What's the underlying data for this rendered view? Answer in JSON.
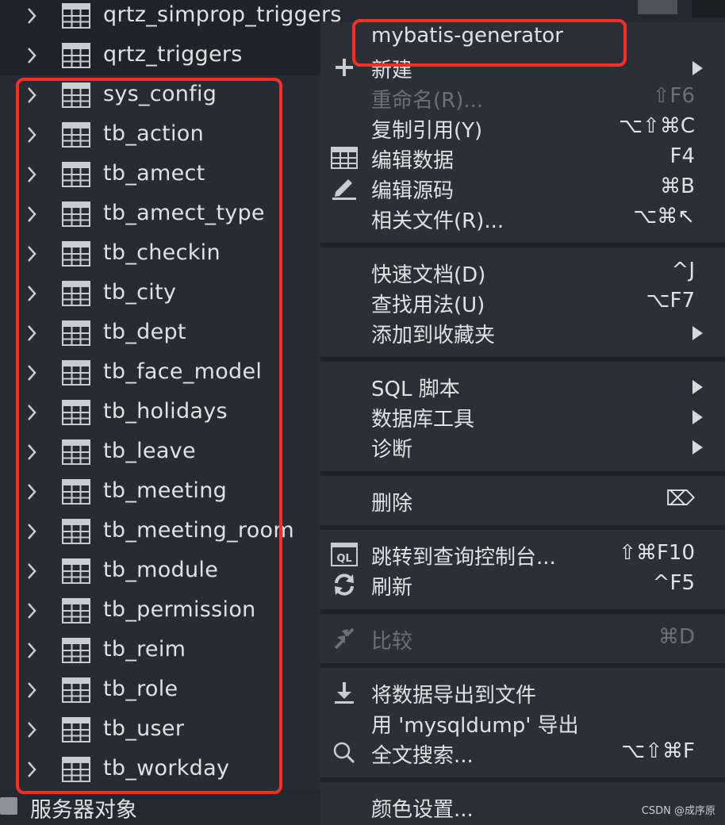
{
  "tree": {
    "partial_rows": [
      "qrtz_simprop_triggers",
      "qrtz_triggers"
    ],
    "tables": [
      "sys_config",
      "tb_action",
      "tb_amect",
      "tb_amect_type",
      "tb_checkin",
      "tb_city",
      "tb_dept",
      "tb_face_model",
      "tb_holidays",
      "tb_leave",
      "tb_meeting",
      "tb_meeting_room",
      "tb_module",
      "tb_permission",
      "tb_reim",
      "tb_role",
      "tb_user",
      "tb_workday"
    ],
    "server_objects_label": "服务器对象"
  },
  "menu": {
    "mybatis_generator": "mybatis-generator",
    "new": "新建",
    "rename": {
      "label": "重命名(R)...",
      "shortcut": "⇧F6"
    },
    "copy_reference": {
      "label": "复制引用(Y)",
      "shortcut": "⌥⇧⌘C"
    },
    "edit_data": {
      "label": "编辑数据",
      "shortcut": "F4"
    },
    "edit_source": {
      "label": "编辑源码",
      "shortcut": "⌘B"
    },
    "related_files": {
      "label": "相关文件(R)...",
      "shortcut": "⌥⌘↖"
    },
    "quick_doc": {
      "label": "快速文档(D)",
      "shortcut": "^J"
    },
    "find_usages": {
      "label": "查找用法(U)",
      "shortcut": "⌥F7"
    },
    "add_to_favorites": "添加到收藏夹",
    "sql_scripts": "SQL 脚本",
    "db_tools": "数据库工具",
    "diagnostics": "诊断",
    "delete": {
      "label": "删除",
      "shortcut": "⌦"
    },
    "jump_to_console": {
      "label": "跳转到查询控制台...",
      "shortcut": "⇧⌘F10"
    },
    "refresh": {
      "label": "刷新",
      "shortcut": "^F5"
    },
    "compare": {
      "label": "比较",
      "shortcut": "⌘D"
    },
    "export_to_file": "将数据导出到文件",
    "mysqldump_export": "用 'mysqldump' 导出",
    "full_text_search": {
      "label": "全文搜索...",
      "shortcut": "⌥⇧⌘F"
    },
    "color_settings": "颜色设置..."
  },
  "watermark": "CSDN @成序原",
  "colors": {
    "highlight_border": "#ff2c25",
    "background": "#232831",
    "menu_background": "#2b2f37"
  }
}
